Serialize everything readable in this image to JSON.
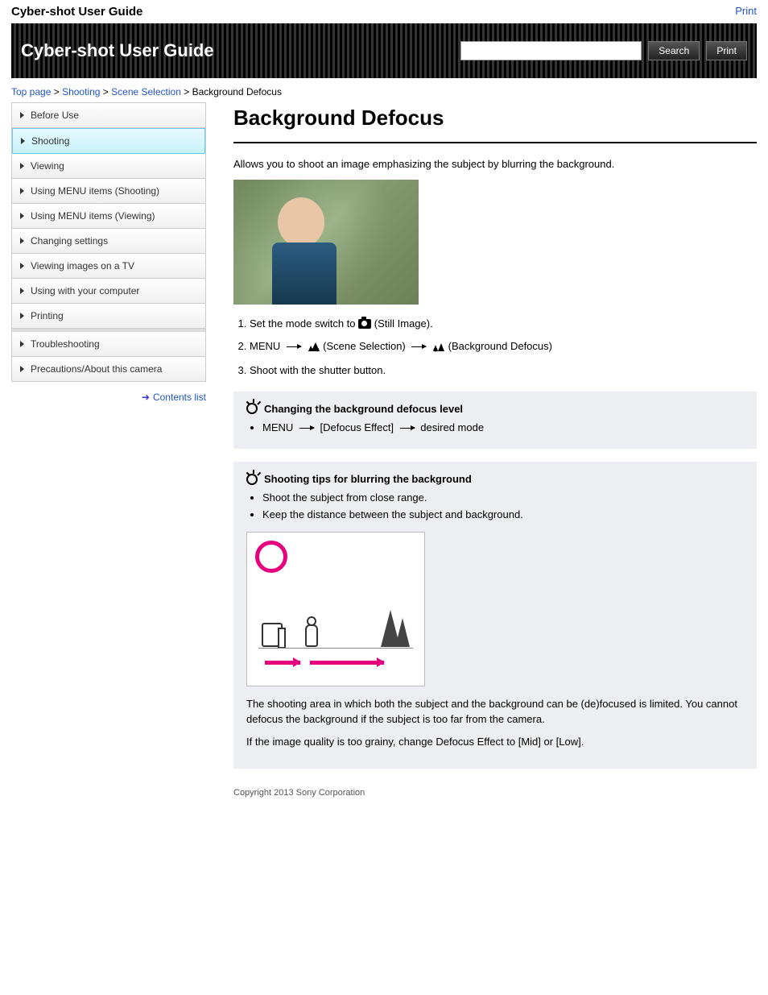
{
  "top": {
    "brand": "Cyber-shot User Guide",
    "print_link": "Print"
  },
  "header": {
    "title": "Cyber-shot User Guide",
    "search_placeholder": "",
    "search_btn": "Search",
    "print_btn": "Print"
  },
  "crumbs": {
    "a": "Top page",
    "b": "Shooting",
    "c": "Scene Selection",
    "d": "Background Defocus"
  },
  "sidebar": {
    "items": [
      {
        "label": "Before Use"
      },
      {
        "label": "Shooting"
      },
      {
        "label": "Viewing"
      },
      {
        "label": "Using MENU items (Shooting)"
      },
      {
        "label": "Using MENU items (Viewing)"
      },
      {
        "label": "Changing settings"
      },
      {
        "label": "Viewing images on a TV"
      },
      {
        "label": "Using with your computer"
      },
      {
        "label": "Printing"
      },
      {
        "label": "Troubleshooting"
      },
      {
        "label": "Precautions/About this camera"
      }
    ],
    "active_index": 1,
    "top_search_link": "Contents list"
  },
  "page": {
    "h1": "Background Defocus",
    "intro": "Allows you to shoot an image emphasizing the subject by blurring the background.",
    "steps": {
      "s1_a": "Set the mode switch to ",
      "s1_b": " (Still Image).",
      "s2_a": "MENU ",
      "s2_b": " (Scene Selection) ",
      "s2_c": " (Background Defocus)",
      "s3": "Shoot with the shutter button."
    },
    "tip1": {
      "title": "Changing the background defocus level",
      "text_a": "MENU ",
      "text_b": " [Defocus Effect] ",
      "text_c": " desired mode"
    },
    "tip2": {
      "title": "Shooting tips for blurring the background",
      "bul1": "Shoot the subject from close range.",
      "bul2": "Keep the distance between the subject and background.",
      "p1": "The shooting area in which both the subject and the background can be (de)focused is limited. You cannot defocus the background if the subject is too far from the camera.",
      "p2": "If the image quality is too grainy, change Defocus Effect to [Mid] or [Low]."
    },
    "copyright": "Copyright 2013 Sony Corporation"
  }
}
